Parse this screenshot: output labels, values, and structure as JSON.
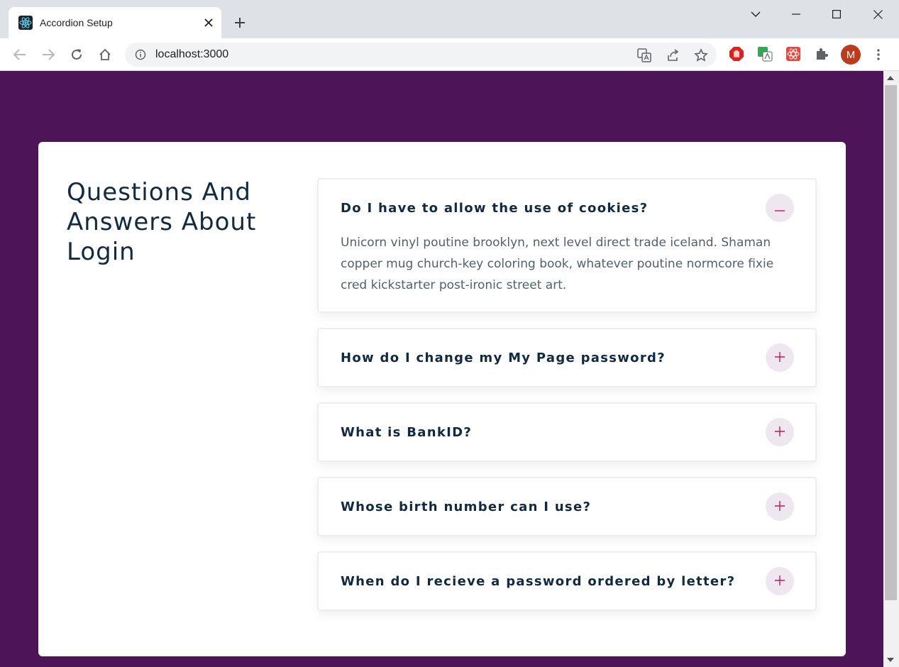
{
  "browser": {
    "tab_title": "Accordion Setup",
    "url": "localhost:3000",
    "profile_initial": "M"
  },
  "colors": {
    "page_background": "#4d1457",
    "accent": "#c2185b",
    "heading_text": "#102a43",
    "answer_text": "#52606d",
    "toggle_background": "#efe7ef"
  },
  "page": {
    "title": "Questions And Answers About Login",
    "faqs": [
      {
        "question": "Do I have to allow the use of cookies?",
        "answer": "Unicorn vinyl poutine brooklyn, next level direct trade iceland. Shaman copper mug church-key coloring book, whatever poutine normcore fixie cred kickstarter post-ironic street art.",
        "expanded": true,
        "toggle_icon": "minus-icon"
      },
      {
        "question": "How do I change my My Page password?",
        "expanded": false,
        "toggle_icon": "plus-icon"
      },
      {
        "question": "What is BankID?",
        "expanded": false,
        "toggle_icon": "plus-icon"
      },
      {
        "question": "Whose birth number can I use?",
        "expanded": false,
        "toggle_icon": "plus-icon"
      },
      {
        "question": "When do I recieve a password ordered by letter?",
        "expanded": false,
        "toggle_icon": "plus-icon"
      }
    ]
  }
}
